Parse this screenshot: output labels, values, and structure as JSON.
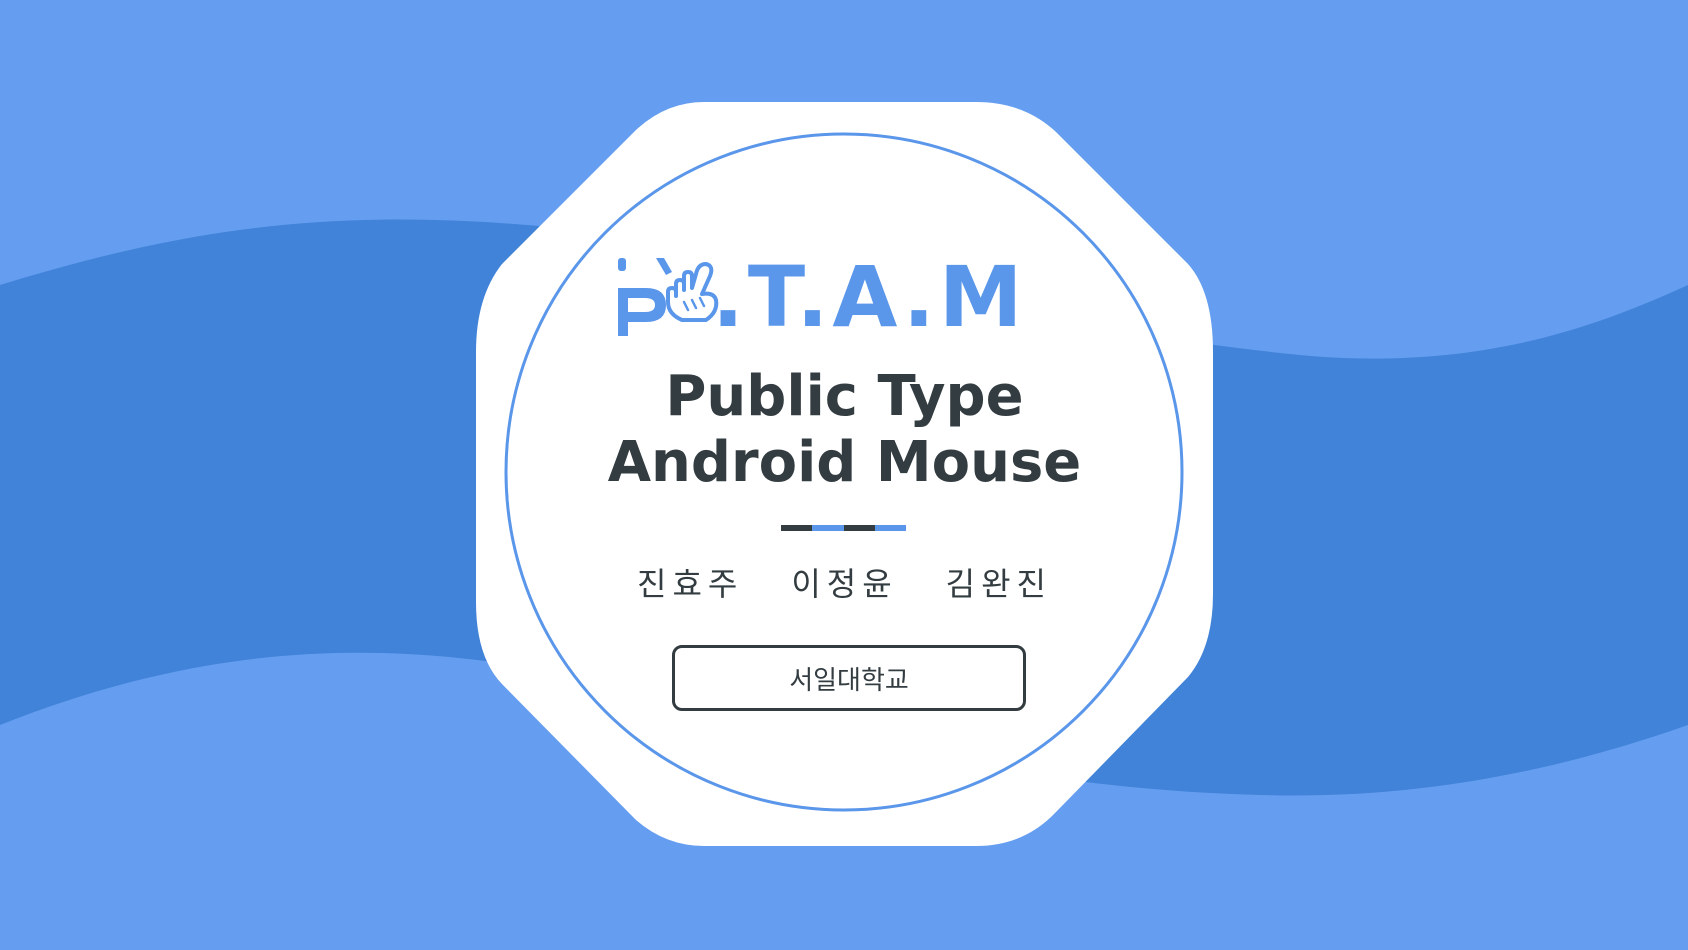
{
  "colors": {
    "background_light": "#659ef0",
    "background_dark": "#4183d8",
    "card": "#ffffff",
    "accent_blue": "#5a96ea",
    "text_dark": "#333c40"
  },
  "logo": {
    "letter": "P",
    "icon": "hand-pointer-icon",
    "text": ".T.A.M"
  },
  "title": {
    "line1": "Public Type",
    "line2": "Android Mouse"
  },
  "divider": {
    "colors": [
      "#333c40",
      "#5a96ea",
      "#333c40",
      "#5a96ea"
    ]
  },
  "authors": [
    "진효주",
    "이정윤",
    "김완진"
  ],
  "school": {
    "label": "서일대학교"
  }
}
